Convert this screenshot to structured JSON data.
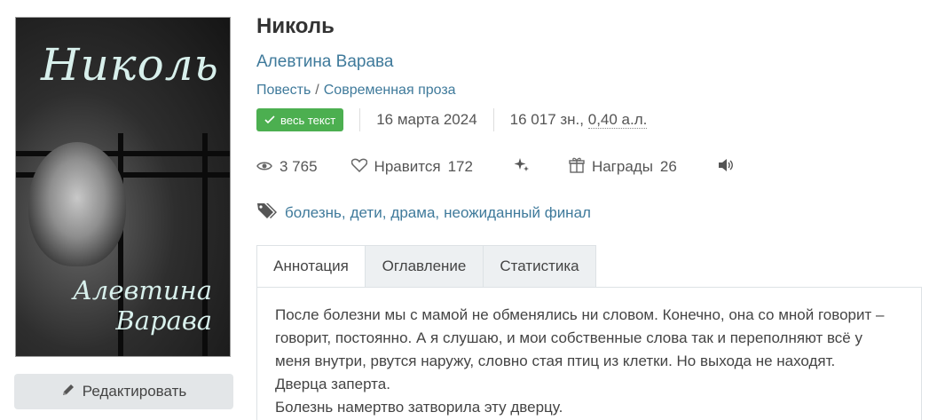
{
  "cover": {
    "title": "Николь",
    "author_line1": "Алевтина",
    "author_line2": "Варава"
  },
  "edit_button": {
    "label": "Редактировать",
    "icon": "pencil-icon"
  },
  "book": {
    "title": "Николь",
    "author": "Алевтина Варава",
    "type": "Повесть",
    "separator": "/",
    "genre": "Современная проза"
  },
  "meta": {
    "badge_label": "весь текст",
    "date": "16 марта 2024",
    "size_chars": "16 017 зн., ",
    "size_al": "0,40 а.л."
  },
  "stats": {
    "views": "3 765",
    "likes_label": "Нравится",
    "likes": "172",
    "awards_label": "Награды",
    "awards": "26"
  },
  "tags": [
    {
      "label": "болезнь"
    },
    {
      "label": "дети"
    },
    {
      "label": "драма"
    },
    {
      "label": "неожиданный финал"
    }
  ],
  "tabs": [
    {
      "label": "Аннотация",
      "active": true
    },
    {
      "label": "Оглавление",
      "active": false
    },
    {
      "label": "Статистика",
      "active": false
    }
  ],
  "annotation": {
    "lines": [
      "После болезни мы с мамой не обменялись ни словом. Конечно, она со мной говорит –",
      "говорит, постоянно. А я слушаю, и мои собственные слова так и переполняют всё у",
      "меня внутри, рвутся наружу, словно стая птиц из клетки. Но выхода не находят.",
      "Дверца заперта.",
      "Болезнь намертво затворила эту дверцу."
    ]
  },
  "colors": {
    "link": "#3f7a9b",
    "badge": "#4caf50",
    "tab_bg": "#edf0f2"
  }
}
